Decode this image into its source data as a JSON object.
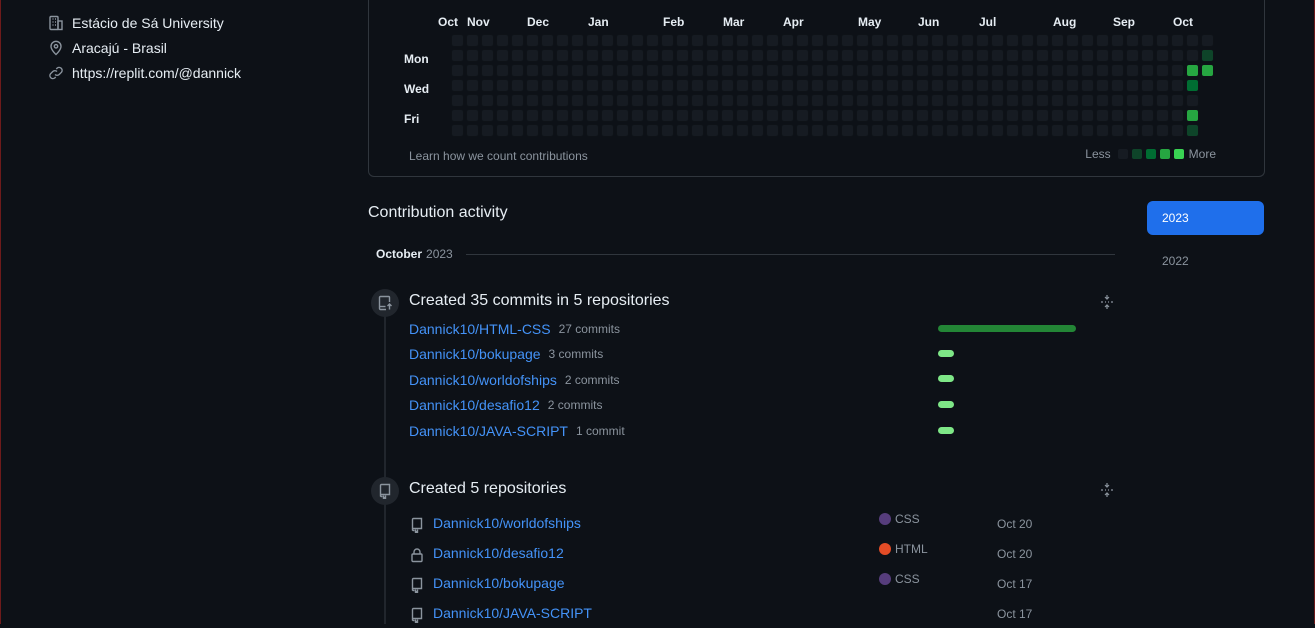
{
  "profile": {
    "organization": "Estácio de Sá University",
    "location": "Aracajú - Brasil",
    "website": "https://replit.com/@dannick"
  },
  "contribution_graph": {
    "months": [
      "Oct",
      "Nov",
      "Dec",
      "Jan",
      "Feb",
      "Mar",
      "Apr",
      "May",
      "Jun",
      "Jul",
      "Aug",
      "Sep",
      "Oct"
    ],
    "days": [
      "Mon",
      "Wed",
      "Fri"
    ],
    "learn_link": "Learn how we count contributions",
    "legend_less": "Less",
    "legend_more": "More",
    "colors": [
      "#161b22",
      "#0e4429",
      "#006d32",
      "#26a641",
      "#39d353"
    ],
    "active_cells": [
      {
        "week": 49,
        "day": 2,
        "level": 3
      },
      {
        "week": 49,
        "day": 3,
        "level": 2
      },
      {
        "week": 49,
        "day": 5,
        "level": 3
      },
      {
        "week": 49,
        "day": 6,
        "level": 1
      },
      {
        "week": 50,
        "day": 1,
        "level": 1
      },
      {
        "week": 50,
        "day": 2,
        "level": 3
      }
    ]
  },
  "activity": {
    "title": "Contribution activity",
    "years": [
      "2023",
      "2022"
    ],
    "month": "October",
    "month_year": "2023",
    "commits_section": {
      "title": "Created 35 commits in 5 repositories",
      "items": [
        {
          "repo": "Dannick10/HTML-CSS",
          "count": "27 commits",
          "commits": 27
        },
        {
          "repo": "Dannick10/bokupage",
          "count": "3 commits",
          "commits": 3
        },
        {
          "repo": "Dannick10/worldofships",
          "count": "2 commits",
          "commits": 2
        },
        {
          "repo": "Dannick10/desafio12",
          "count": "2 commits",
          "commits": 2
        },
        {
          "repo": "Dannick10/JAVA-SCRIPT",
          "count": "1 commit",
          "commits": 1
        }
      ]
    },
    "repos_section": {
      "title": "Created 5 repositories",
      "items": [
        {
          "name": "Dannick10/worldofships",
          "language": "CSS",
          "lang_color": "#563d7c",
          "date": "Oct 20",
          "icon": "repo-icon"
        },
        {
          "name": "Dannick10/desafio12",
          "language": "HTML",
          "lang_color": "#e34c26",
          "date": "Oct 20",
          "icon": "lock-icon"
        },
        {
          "name": "Dannick10/bokupage",
          "language": "CSS",
          "lang_color": "#563d7c",
          "date": "Oct 17",
          "icon": "repo-icon"
        },
        {
          "name": "Dannick10/JAVA-SCRIPT",
          "language": "",
          "lang_color": "",
          "date": "Oct 17",
          "icon": "repo-icon"
        }
      ]
    }
  }
}
